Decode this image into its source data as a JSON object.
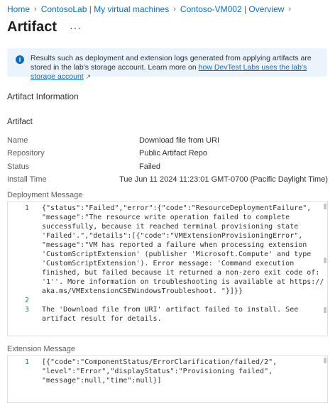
{
  "breadcrumb": [
    {
      "label": "Home"
    },
    {
      "label": "ContosoLab | My virtual machines"
    },
    {
      "label": "Contoso-VM002 | Overview"
    }
  ],
  "page": {
    "title": "Artifact",
    "more_label": "···"
  },
  "info_banner": {
    "text_before_link": "Results such as deployment and extension logs generated from applying artifacts are stored in the lab's storage account. Learn more on ",
    "link_text": "how DevTest Labs uses the lab's storage account",
    "link_icon": "↗"
  },
  "sections": {
    "artifact_information": "Artifact Information",
    "artifact": "Artifact"
  },
  "properties": [
    {
      "label": "Name",
      "value": "Download file from URI"
    },
    {
      "label": "Repository",
      "value": "Public Artifact Repo"
    },
    {
      "label": "Status",
      "value": "Failed"
    },
    {
      "label": "Install Time",
      "value": "Tue Jun 11 2024 11:23:01 GMT-0700 (Pacific Daylight Time)"
    }
  ],
  "deployment_message": {
    "label": "Deployment Message",
    "lines": [
      {
        "num": "1",
        "text": "{\"status\":\"Failed\",\"error\":{\"code\":\"ResourceDeploymentFailure\","
      },
      {
        "num": "",
        "text": "\"message\":\"The resource write operation failed to complete"
      },
      {
        "num": "",
        "text": "successfully, because it reached terminal provisioning state"
      },
      {
        "num": "",
        "text": "'Failed'.\",\"details\":[{\"code\":\"VMExtensionProvisioningError\","
      },
      {
        "num": "",
        "text": "\"message\":\"VM has reported a failure when processing extension"
      },
      {
        "num": "",
        "text": "'CustomScriptExtension' (publisher 'Microsoft.Compute' and type"
      },
      {
        "num": "",
        "text": "'CustomScriptExtension'). Error message: 'Command execution"
      },
      {
        "num": "",
        "text": "finished, but failed because it returned a non-zero exit code of:"
      },
      {
        "num": "",
        "text": "'1''. More information on troubleshooting is available at https://"
      },
      {
        "num": "",
        "text": "aka.ms/VMExtensionCSEWindowsTroubleshoot. \"}]}}"
      },
      {
        "num": "2",
        "text": ""
      },
      {
        "num": "3",
        "text": "The 'Download file from URI' artifact failed to install. See"
      },
      {
        "num": "",
        "text": "artifact result for details."
      }
    ]
  },
  "extension_message": {
    "label": "Extension Message",
    "lines": [
      {
        "num": "1",
        "text": "[{\"code\":\"ComponentStatus/ErrorClarification/failed/2\","
      },
      {
        "num": "",
        "text": "\"level\":\"Error\",\"displayStatus\":\"Provisioning failed\","
      },
      {
        "num": "",
        "text": "\"message\":null,\"time\":null}]"
      }
    ]
  },
  "colors": {
    "accent": "#0f6cbd",
    "banner_bg": "#ebf3fc",
    "line_number": "#237893"
  }
}
